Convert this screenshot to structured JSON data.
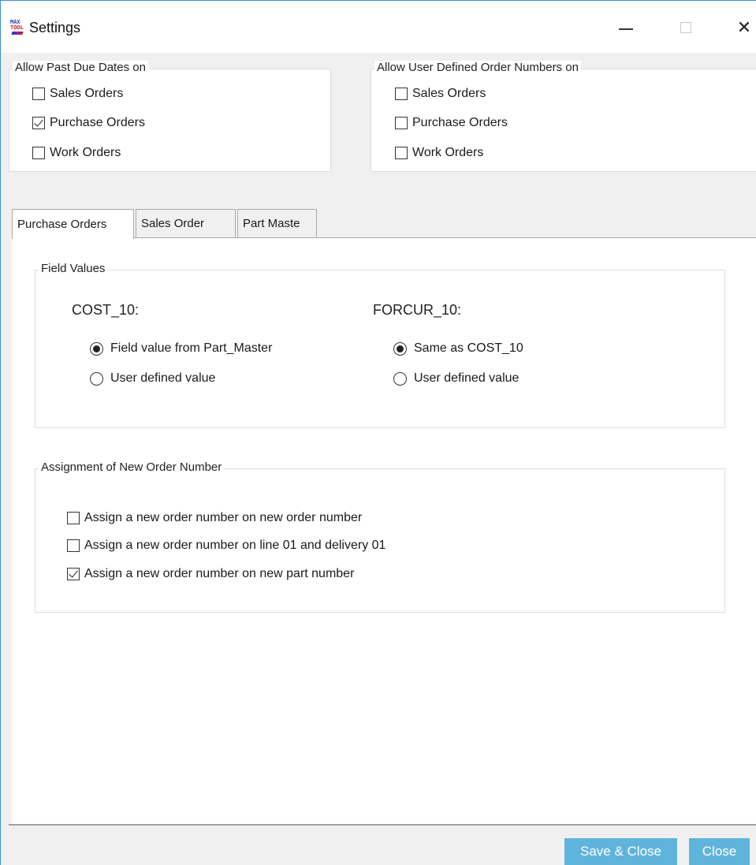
{
  "window": {
    "title": "Settings",
    "icon_text_top": "MAX",
    "icon_text_bottom": "TOOL",
    "close_glyph": "✕"
  },
  "past_due": {
    "title": "Allow Past Due Dates on",
    "options": [
      {
        "label": "Sales Orders",
        "checked": false
      },
      {
        "label": "Purchase Orders",
        "checked": true
      },
      {
        "label": "Work Orders",
        "checked": false
      }
    ]
  },
  "user_defined": {
    "title": "Allow User Defined Order Numbers on",
    "options": [
      {
        "label": "Sales Orders",
        "checked": false
      },
      {
        "label": "Purchase Orders",
        "checked": false
      },
      {
        "label": "Work Orders",
        "checked": false
      }
    ]
  },
  "tabs": [
    {
      "label": "Purchase Orders",
      "active": true
    },
    {
      "label": "Sales Order",
      "active": false
    },
    {
      "label": "Part Maste",
      "active": false
    }
  ],
  "field_values": {
    "title": "Field Values",
    "cost": {
      "label": "COST_10:",
      "options": [
        {
          "label": "Field value from Part_Master",
          "checked": true
        },
        {
          "label": "User defined value",
          "checked": false
        }
      ]
    },
    "forcur": {
      "label": "FORCUR_10:",
      "options": [
        {
          "label": "Same as COST_10",
          "checked": true
        },
        {
          "label": "User defined value",
          "checked": false
        }
      ]
    }
  },
  "assignment": {
    "title": "Assignment of New Order Number",
    "options": [
      {
        "label": "Assign a new order number on new order number",
        "checked": false
      },
      {
        "label": "Assign a new order number on line 01 and delivery 01",
        "checked": false
      },
      {
        "label": "Assign a new order number on new part number",
        "checked": true
      }
    ]
  },
  "buttons": {
    "save_close": "Save & Close",
    "close": "Close"
  },
  "colors": {
    "button_bg": "#5fb4dc",
    "window_border": "#3c8fd6"
  }
}
